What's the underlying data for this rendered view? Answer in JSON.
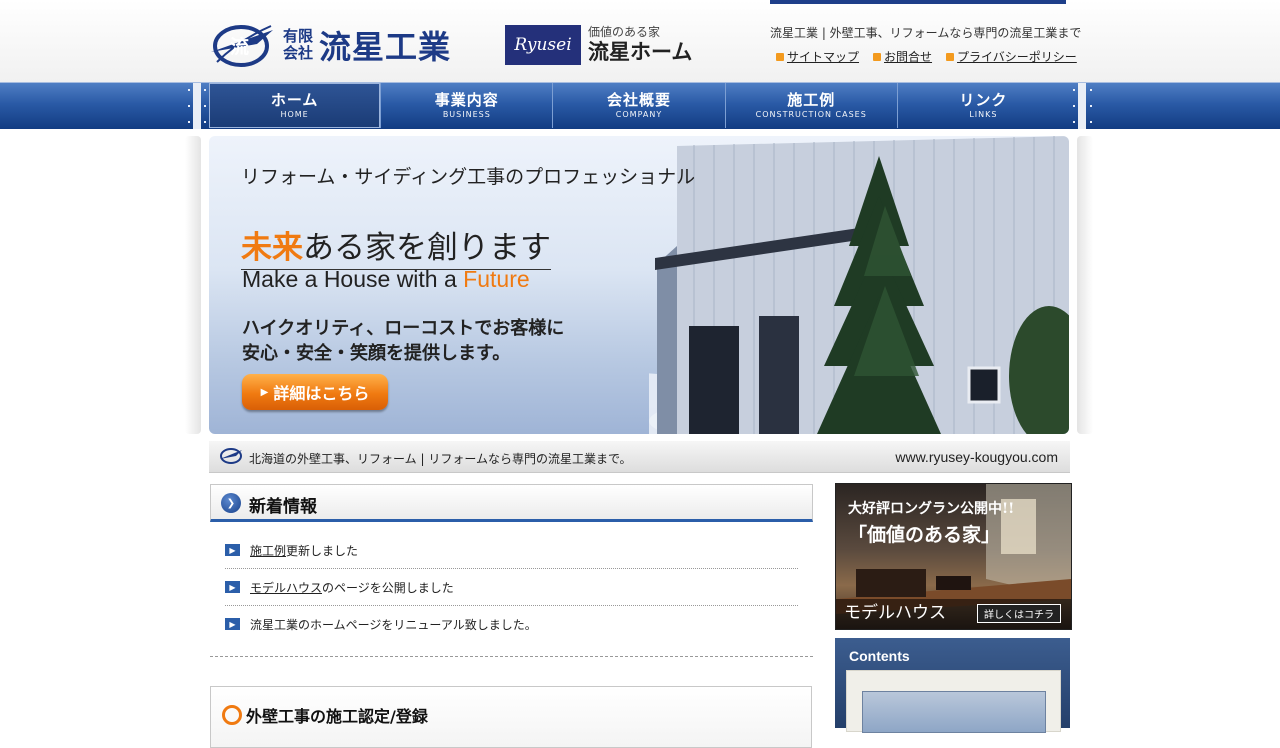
{
  "header": {
    "company_kind_line1": "有限",
    "company_kind_line2": "会社",
    "company_name": "流星工業",
    "logo_mark_text": "流",
    "brand_logo_text": "Ryusei",
    "brand_tagline": "価値のある家",
    "brand_name": "流星ホーム",
    "site_tagline": "流星工業 | 外壁工事、リフォームなら専門の流星工業まで",
    "util_links": [
      {
        "label": "サイトマップ"
      },
      {
        "label": "お問合せ"
      },
      {
        "label": "プライバシーポリシー"
      }
    ]
  },
  "nav": {
    "items": [
      {
        "jp": "ホーム",
        "en": "HOME",
        "active": true
      },
      {
        "jp": "事業内容",
        "en": "BUSINESS",
        "active": false
      },
      {
        "jp": "会社概要",
        "en": "COMPANY",
        "active": false
      },
      {
        "jp": "施工例",
        "en": "CONSTRUCTION CASES",
        "active": false
      },
      {
        "jp": "リンク",
        "en": "LINKS",
        "active": false
      }
    ]
  },
  "hero": {
    "subtitle": "リフォーム・サイディング工事のプロフェッショナル",
    "title_accent": "未来",
    "title_rest": "ある家を創ります",
    "en_main": "Make a House with a ",
    "en_accent": "Future",
    "body_line1": "ハイクオリティ、ローコストでお客様に",
    "body_line2": "安心・安全・笑顔を提供します。",
    "cta_label": "詳細はこちら"
  },
  "info_bar": {
    "text": "北海道の外壁工事、リフォーム | リフォームなら専門の流星工業まで。",
    "url": "www.ryusey-kougyou.com"
  },
  "news": {
    "title": "新着情報",
    "items": [
      {
        "link": "施工例",
        "text": "更新しました"
      },
      {
        "link": "モデルハウス",
        "text": "のページを公開しました"
      },
      {
        "link": "",
        "text": "流星工業のホームページをリニューアル致しました。"
      }
    ]
  },
  "cert": {
    "title": "外壁工事の施工認定/登録"
  },
  "sidebar": {
    "model_headline": "大好評ロングラン公開中!!",
    "model_quote": "「価値のある家」",
    "model_label": "モデルハウス",
    "model_detail_button": "詳しくはコチラ",
    "contents_title": "Contents"
  },
  "colors": {
    "brand_blue": "#1d3a86",
    "nav_blue": "#2a5aa6",
    "accent_orange": "#f07a11"
  }
}
